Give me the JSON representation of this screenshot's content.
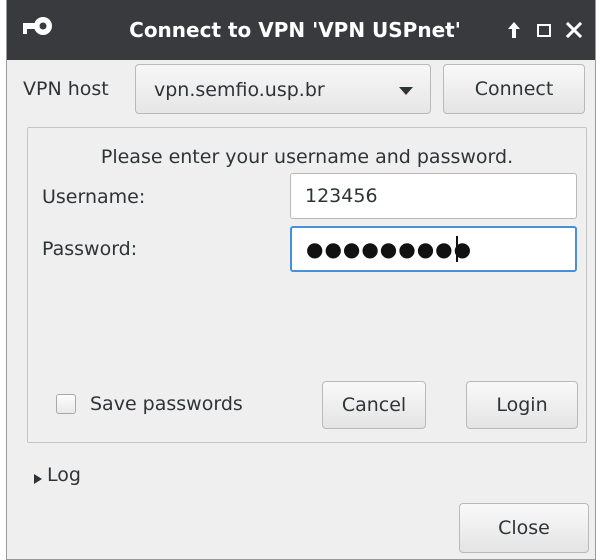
{
  "window": {
    "title": "Connect to VPN 'VPN USPnet'",
    "title_icon": "key-icon",
    "controls": [
      "pin-icon",
      "maximize-icon",
      "close-icon"
    ]
  },
  "host_row": {
    "label": "VPN host",
    "selected_host": "vpn.semfio.usp.br",
    "connect_label": "Connect"
  },
  "auth": {
    "prompt": "Please enter your username and password.",
    "username_label": "Username:",
    "username_value": "123456",
    "password_label": "Password:",
    "password_mask": "●●●●●●●●●",
    "save_label": "Save passwords",
    "save_checked": false,
    "cancel_label": "Cancel",
    "login_label": "Login"
  },
  "log": {
    "label": "Log",
    "expanded": false
  },
  "footer": {
    "close_label": "Close"
  },
  "colors": {
    "titlebar": "#383a3d",
    "window_bg": "#efefef",
    "focus_border": "#4a90d9"
  }
}
